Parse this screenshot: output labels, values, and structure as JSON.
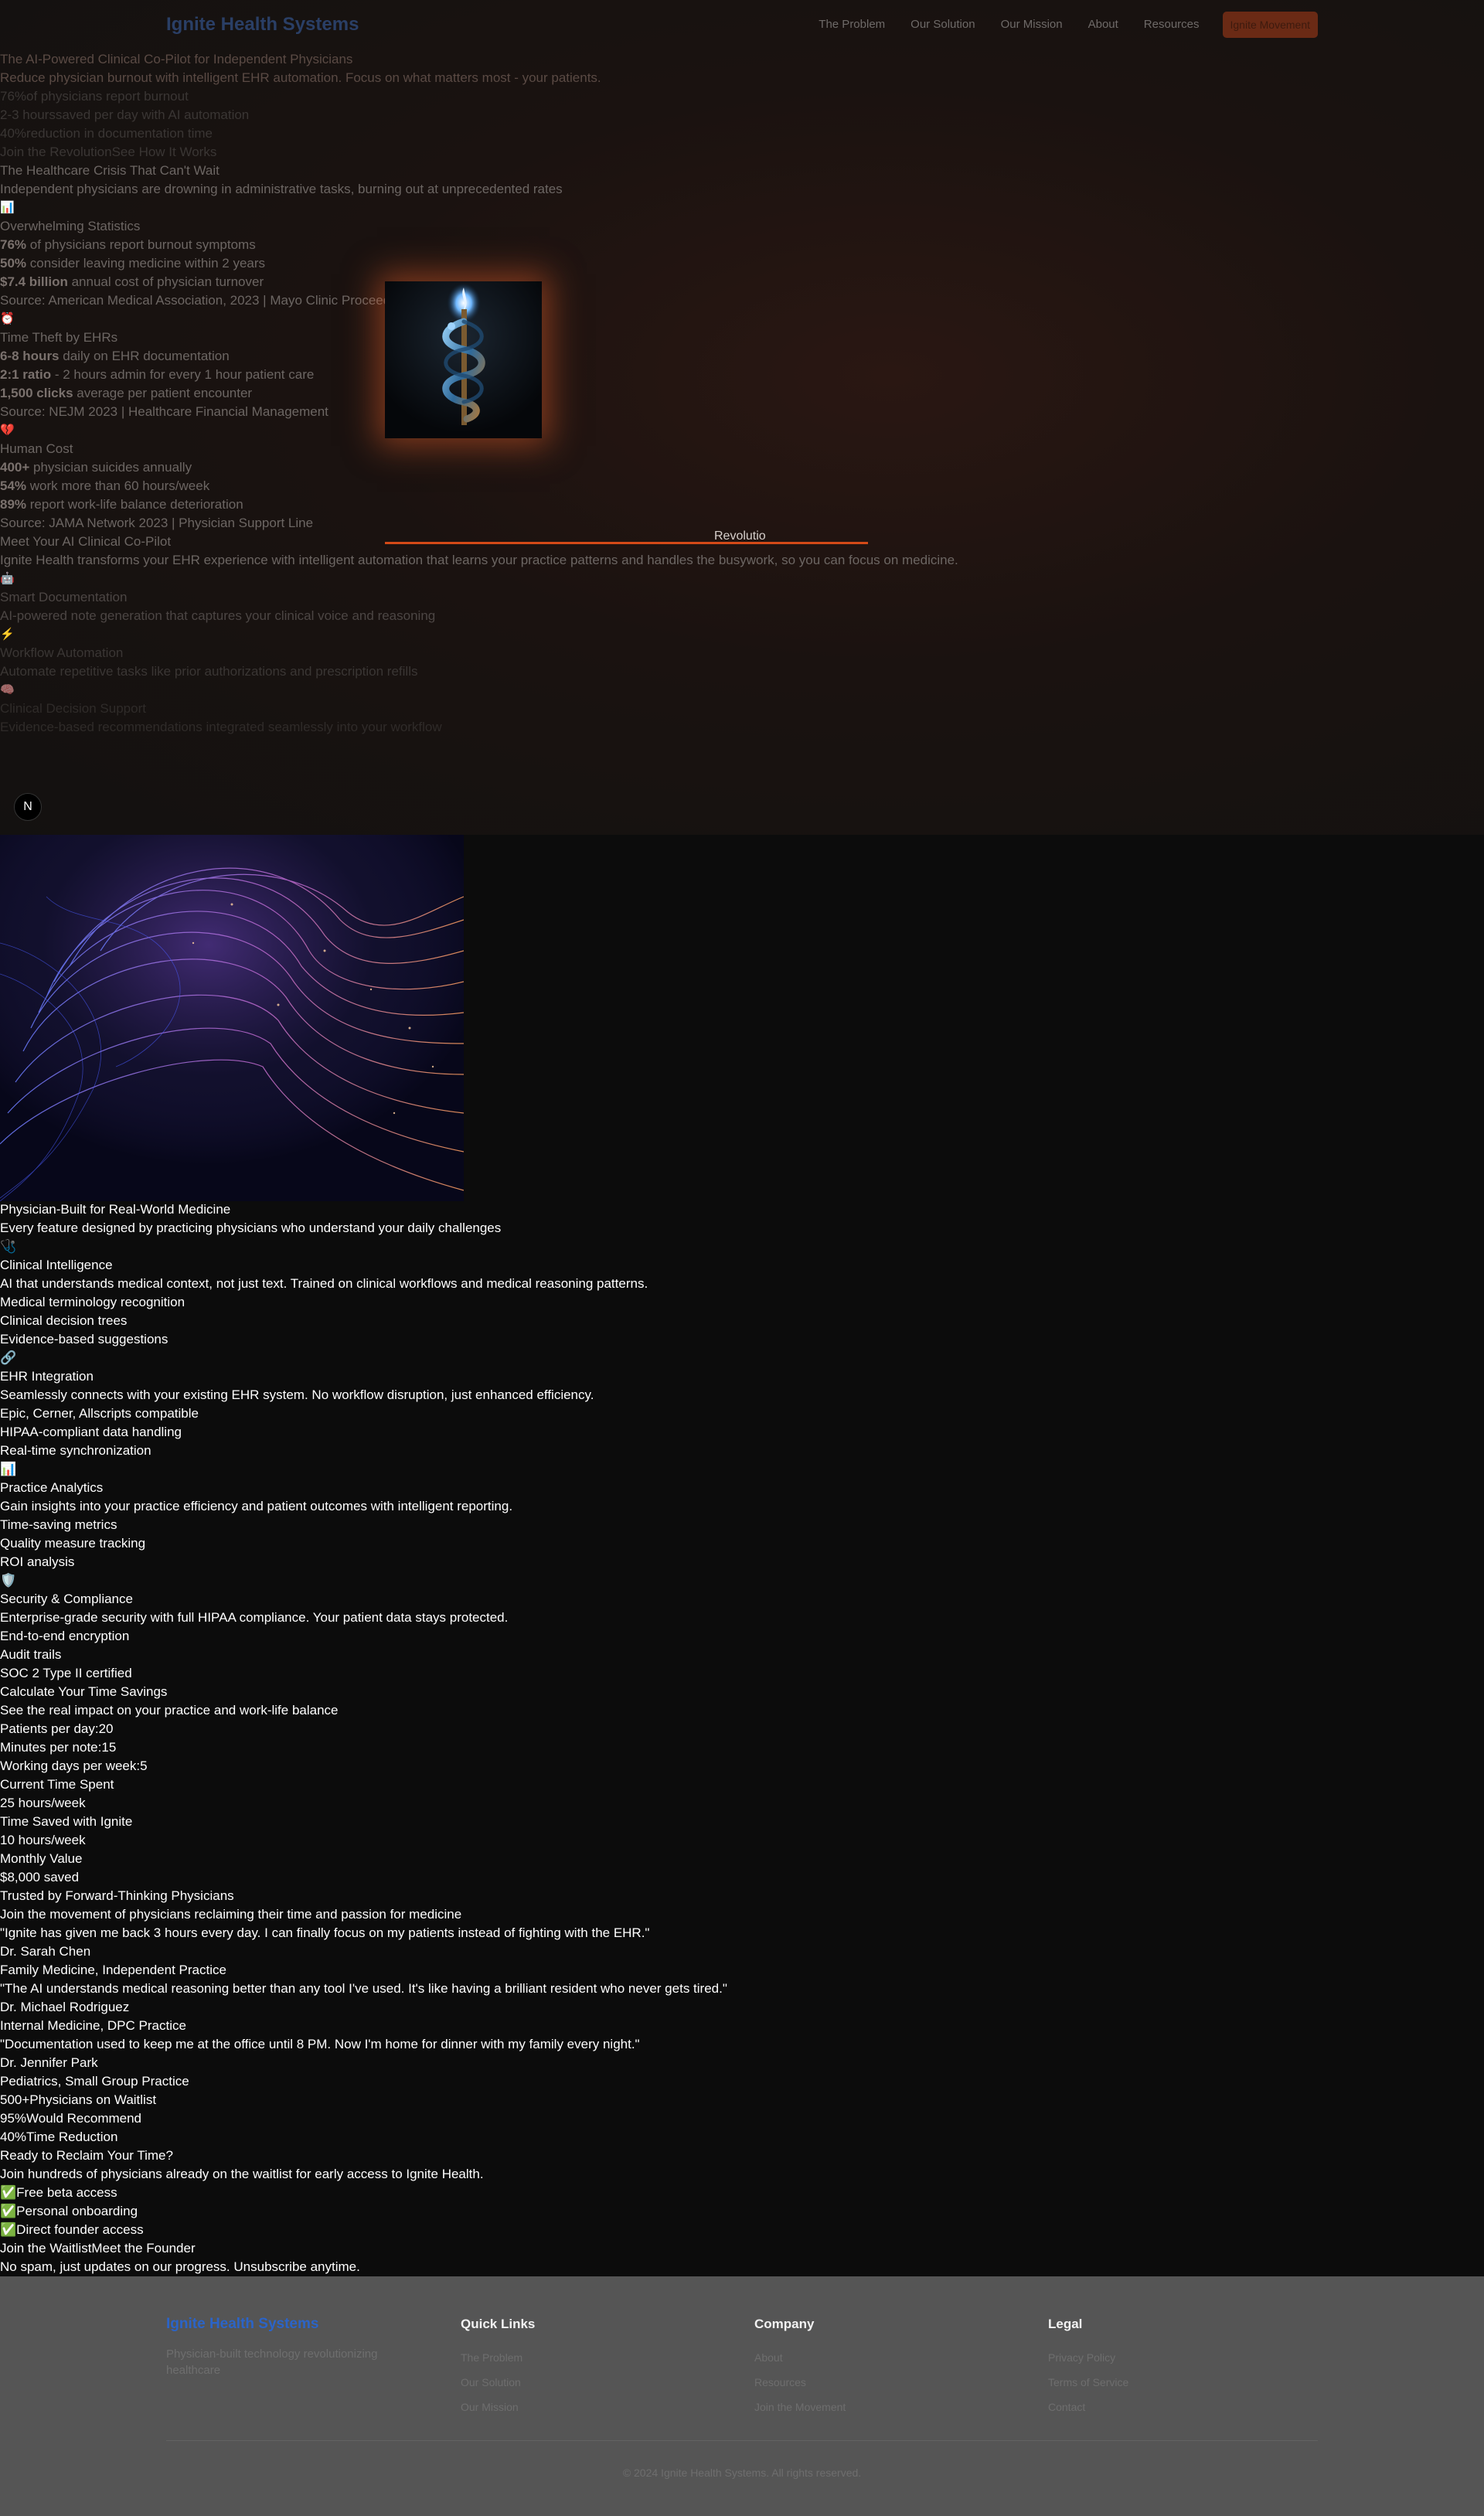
{
  "nav": {
    "brand": "Ignite Health Systems",
    "links": [
      "The Problem",
      "Our Solution",
      "Our Mission",
      "About",
      "Resources"
    ],
    "cta": "Ignite Movement"
  },
  "hero": {
    "eyebrow": "The AI-Powered Clinical Co-Pilot for Independent Physicians",
    "subtitle": "Reduce physician burnout with intelligent EHR automation. Focus on what matters most - your patients.",
    "stats": [
      {
        "value": "76%",
        "label": "of physicians report burnout"
      },
      {
        "value": "2-3 hours",
        "label": "saved per day with AI automation"
      },
      {
        "value": "40%",
        "label": "reduction in documentation time"
      }
    ],
    "cta_primary": "Join the Revolution",
    "cta_secondary": "See How It Works"
  },
  "crisis": {
    "title": "The Healthcare Crisis That Can't Wait",
    "subtitle": "Independent physicians are drowning in administrative tasks, burning out at unprecedented rates",
    "cards": [
      {
        "icon": "📊",
        "icon_name": "bar-chart-icon",
        "title": "Overwhelming Statistics",
        "items": [
          {
            "bold": "76%",
            "text": " of physicians report burnout symptoms"
          },
          {
            "bold": "50%",
            "text": " consider leaving medicine within 2 years"
          },
          {
            "bold": "$7.4 billion",
            "text": " annual cost of physician turnover"
          }
        ],
        "source": "Source: American Medical Association, 2023 | Mayo Clinic Proceedings"
      },
      {
        "icon": "⏰",
        "icon_name": "alarm-clock-icon",
        "title": "Time Theft by EHRs",
        "items": [
          {
            "bold": "6-8 hours",
            "text": " daily on EHR documentation"
          },
          {
            "bold": "2:1 ratio",
            "text": " - 2 hours admin for every 1 hour patient care"
          },
          {
            "bold": "1,500 clicks",
            "text": " average per patient encounter"
          }
        ],
        "source": "Source: NEJM 2023 | Healthcare Financial Management"
      },
      {
        "icon": "💔",
        "icon_name": "broken-heart-icon",
        "title": "Human Cost",
        "items": [
          {
            "bold": "400+",
            "text": " physician suicides annually"
          },
          {
            "bold": "54%",
            "text": " work more than 60 hours/week"
          },
          {
            "bold": "89%",
            "text": " report work-life balance deterioration"
          }
        ],
        "source": "Source: JAMA Network 2023 | Physician Support Line"
      }
    ]
  },
  "revolution": {
    "label": "Revolutio"
  },
  "copilot": {
    "title": "Meet Your AI Clinical Co-Pilot",
    "subtitle": "Ignite Health transforms your EHR experience with intelligent automation that learns your practice patterns and handles the busywork, so you can focus on medicine.",
    "features": [
      {
        "icon": "🤖",
        "icon_name": "robot-icon",
        "title": "Smart Documentation",
        "text": "AI-powered note generation that captures your clinical voice and reasoning"
      },
      {
        "icon": "⚡",
        "icon_name": "lightning-icon",
        "title": "Workflow Automation",
        "text": "Automate repetitive tasks like prior authorizations and prescription refills"
      },
      {
        "icon": "🧠",
        "icon_name": "brain-icon",
        "title": "Clinical Decision Support",
        "text": "Evidence-based recommendations integrated seamlessly into your workflow"
      }
    ]
  },
  "nextjs_badge": "N",
  "physician_built": {
    "title": "Physician-Built for Real-World Medicine",
    "subtitle": "Every feature designed by practicing physicians who understand your daily challenges",
    "features": [
      {
        "icon": "🩺",
        "icon_name": "stethoscope-icon",
        "title": "Clinical Intelligence",
        "text": "AI that understands medical context, not just text. Trained on clinical workflows and medical reasoning patterns.",
        "bullets": [
          "Medical terminology recognition",
          "Clinical decision trees",
          "Evidence-based suggestions"
        ]
      },
      {
        "icon": "🔗",
        "icon_name": "link-icon",
        "title": "EHR Integration",
        "text": "Seamlessly connects with your existing EHR system. No workflow disruption, just enhanced efficiency.",
        "bullets": [
          "Epic, Cerner, Allscripts compatible",
          "HIPAA-compliant data handling",
          "Real-time synchronization"
        ]
      },
      {
        "icon": "📊",
        "icon_name": "bar-chart-icon",
        "title": "Practice Analytics",
        "text": "Gain insights into your practice efficiency and patient outcomes with intelligent reporting.",
        "bullets": [
          "Time-saving metrics",
          "Quality measure tracking",
          "ROI analysis"
        ]
      },
      {
        "icon": "🛡️",
        "icon_name": "shield-icon",
        "title": "Security & Compliance",
        "text": "Enterprise-grade security with full HIPAA compliance. Your patient data stays protected.",
        "bullets": [
          "End-to-end encryption",
          "Audit trails",
          "SOC 2 Type II certified"
        ]
      }
    ]
  },
  "calculator": {
    "title": "Calculate Your Time Savings",
    "subtitle": "See the real impact on your practice and work-life balance",
    "inputs": [
      {
        "label": "Patients per day:",
        "value": "20"
      },
      {
        "label": "Minutes per note:",
        "value": "15"
      },
      {
        "label": "Working days per week:",
        "value": "5"
      }
    ],
    "results": [
      {
        "label": "Current Time Spent",
        "value": "25 hours/week"
      },
      {
        "label": "Time Saved with Ignite",
        "value": "10 hours/week"
      },
      {
        "label": "Monthly Value",
        "value": "$8,000 saved"
      }
    ]
  },
  "testimonials": {
    "title": "Trusted by Forward-Thinking Physicians",
    "subtitle": "Join the movement of physicians reclaiming their time and passion for medicine",
    "items": [
      {
        "quote": "\"Ignite has given me back 3 hours every day. I can finally focus on my patients instead of fighting with the EHR.\"",
        "name": "Dr. Sarah Chen",
        "role": "Family Medicine, Independent Practice"
      },
      {
        "quote": "\"The AI understands medical reasoning better than any tool I've used. It's like having a brilliant resident who never gets tired.\"",
        "name": "Dr. Michael Rodriguez",
        "role": "Internal Medicine, DPC Practice"
      },
      {
        "quote": "\"Documentation used to keep me at the office until 8 PM. Now I'm home for dinner with my family every night.\"",
        "name": "Dr. Jennifer Park",
        "role": "Pediatrics, Small Group Practice"
      }
    ],
    "stats": [
      {
        "value": "500+",
        "label": "Physicians on Waitlist"
      },
      {
        "value": "95%",
        "label": "Would Recommend"
      },
      {
        "value": "40%",
        "label": "Time Reduction"
      }
    ]
  },
  "cta_section": {
    "title": "Ready to Reclaim Your Time?",
    "subtitle": "Join hundreds of physicians already on the waitlist for early access to Ignite Health.",
    "perks": [
      "Free beta access",
      "Personal onboarding",
      "Direct founder access"
    ],
    "perk_icon": "✅",
    "perk_icon_name": "check-box-icon",
    "primary": "Join the Waitlist",
    "secondary": "Meet the Founder",
    "note": "No spam, just updates on our progress. Unsubscribe anytime."
  },
  "footer": {
    "brand": "Ignite Health Systems",
    "tagline": "Physician-built technology revolutionizing healthcare",
    "columns": [
      {
        "title": "Quick Links",
        "links": [
          "The Problem",
          "Our Solution",
          "Our Mission"
        ]
      },
      {
        "title": "Company",
        "links": [
          "About",
          "Resources",
          "Join the Movement"
        ]
      },
      {
        "title": "Legal",
        "links": [
          "Privacy Policy",
          "Terms of Service",
          "Contact"
        ]
      }
    ],
    "copyright": "© 2024 Ignite Health Systems. All rights reserved."
  },
  "colors": {
    "accent": "#d34a18",
    "brand_blue": "#2b64c8",
    "background": "#0c0c0c",
    "footer": "#555555"
  }
}
